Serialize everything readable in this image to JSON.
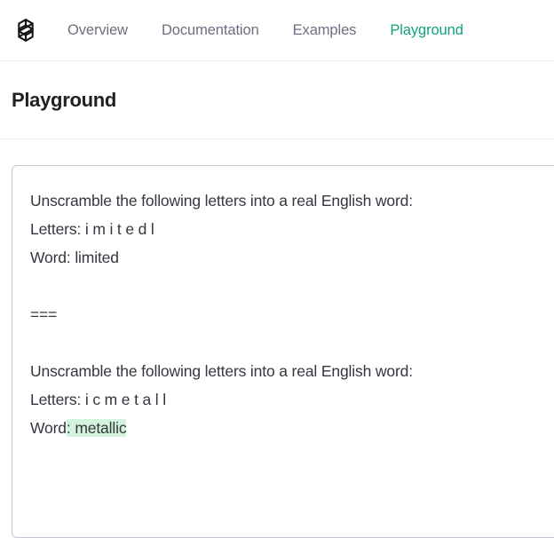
{
  "header": {
    "logo_icon": "openai-logo-icon",
    "nav": [
      {
        "label": "Overview",
        "active": false
      },
      {
        "label": "Documentation",
        "active": false
      },
      {
        "label": "Examples",
        "active": false
      },
      {
        "label": "Playground",
        "active": true
      }
    ]
  },
  "page": {
    "title": "Playground"
  },
  "colors": {
    "accent_green": "#10a37f",
    "completion_highlight": "#d3f3dc",
    "body_text": "#353740",
    "nav_text": "#6e6e80",
    "panel_border": "#c5c5d2",
    "divider": "#ececf1"
  },
  "editor": {
    "prompt_prefix": "Unscramble the following letters into a real English word:\nLetters: i m i t e d l\nWord: limited\n\n===\n\nUnscramble the following letters into a real English word:\nLetters: i c m e t a l l\nWord",
    "completion": ": metallic",
    "examples": [
      {
        "instruction": "Unscramble the following letters into a real English word:",
        "letters_label": "Letters:",
        "letters": "i m i t e d l",
        "word_label": "Word:",
        "word": "limited"
      },
      {
        "instruction": "Unscramble the following letters into a real English word:",
        "letters_label": "Letters:",
        "letters": "i c m e t a l l",
        "word_label": "Word",
        "word": ": metallic"
      }
    ],
    "separator": "==="
  }
}
